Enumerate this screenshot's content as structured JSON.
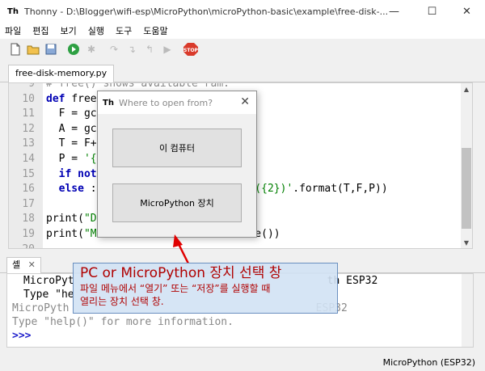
{
  "window": {
    "title": "Thonny  -  D:\\Blogger\\wifi-esp\\MicroPython\\microPython-basic\\example\\free-disk-...",
    "minimize": "—",
    "maximize": "☐",
    "close": "✕"
  },
  "menu": [
    "파일",
    "편집",
    "보기",
    "실행",
    "도구",
    "도움말"
  ],
  "toolbar": {
    "new": "🗋",
    "open": "📂",
    "save": "💾",
    "run": "▶",
    "debug": "✱",
    "step_over": "↷",
    "step_into": "↴",
    "step_out": "↰",
    "resume": "▶",
    "stop": "STOP"
  },
  "editor": {
    "tab_label": "free-disk-memory.py",
    "lines": [
      {
        "n": "9",
        "segments": [
          {
            "t": "# free() shows available ram.",
            "c": "cm"
          }
        ]
      },
      {
        "n": "10",
        "segments": [
          {
            "t": "def ",
            "c": "kw"
          },
          {
            "t": "free",
            "c": ""
          }
        ]
      },
      {
        "n": "11",
        "segments": [
          {
            "t": "  F = gc",
            "c": ""
          }
        ]
      },
      {
        "n": "12",
        "segments": [
          {
            "t": "  A = gc",
            "c": ""
          }
        ]
      },
      {
        "n": "13",
        "segments": [
          {
            "t": "  T = F+",
            "c": ""
          }
        ]
      },
      {
        "n": "14",
        "segments": [
          {
            "t": "  P = ",
            "c": ""
          },
          {
            "t": "'{",
            "c": "str"
          }
        ]
      },
      {
        "n": "15",
        "segments": [
          {
            "t": "  if not",
            "c": "kw"
          }
        ]
      },
      {
        "n": "16",
        "segments": [
          {
            "t": "  else ",
            "c": "kw"
          },
          {
            "t": ":",
            "c": ""
          },
          {
            "t": "                    ",
            "c": ""
          },
          {
            "t": ":{1} ({2})'",
            "c": "str"
          },
          {
            "t": ".format(T,F,P))",
            "c": ""
          }
        ]
      },
      {
        "n": "17",
        "segments": [
          {
            "t": "",
            "c": ""
          }
        ]
      },
      {
        "n": "18",
        "segments": [
          {
            "t": "print(",
            "c": ""
          },
          {
            "t": "\"D",
            "c": "str"
          }
        ]
      },
      {
        "n": "19",
        "segments": [
          {
            "t": "print(",
            "c": ""
          },
          {
            "t": "\"M",
            "c": "str"
          },
          {
            "t": "                         e())",
            "c": ""
          }
        ]
      },
      {
        "n": "20",
        "segments": [
          {
            "t": "",
            "c": ""
          }
        ]
      }
    ]
  },
  "shell": {
    "tab_label": "셸",
    "lines": [
      {
        "t": "MicroPyt                                        th ESP32",
        "c": "first"
      },
      {
        "t": "Type \"he",
        "c": ""
      },
      {
        "t": "MicroPyth                                       ESP32",
        "c": "grey"
      },
      {
        "t": "Type \"help()\" for more information.",
        "c": "grey"
      },
      {
        "t": ">>>",
        "c": "prompt"
      }
    ]
  },
  "status": "MicroPython (ESP32)",
  "dialog": {
    "title": "Where to open from?",
    "close": "✕",
    "btn_computer": "이 컴퓨터",
    "btn_device": "MicroPython 장치"
  },
  "annotation": {
    "title": "PC or MicroPython 장치 선택 창",
    "line1": "파일 메뉴에서 “열기” 또는 “저장”를 실행할 때",
    "line2": "열리는 장치 선택 창."
  },
  "colors": {
    "annotation_text": "#b00000",
    "annotation_bg": "#d2e2f4",
    "arrow": "#e00000"
  }
}
